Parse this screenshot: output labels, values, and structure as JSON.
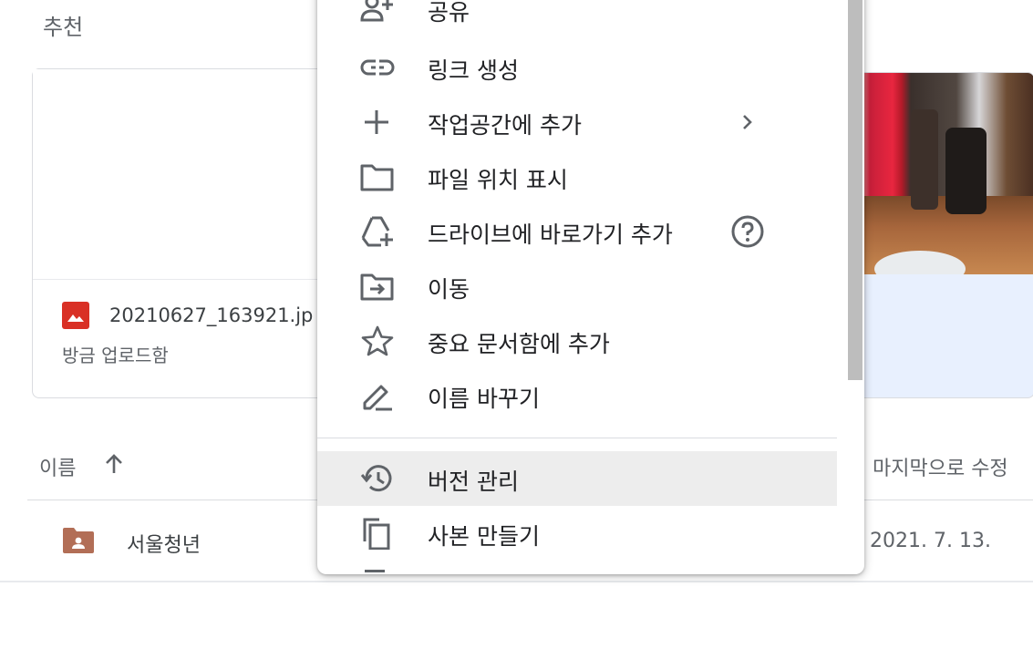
{
  "section": {
    "title": "추천"
  },
  "suggested": {
    "file_name": "20210627_163921.jp",
    "file_sub": "방금 업로드함",
    "file_type_icon": "image-icon",
    "file_type_color": "#d93025"
  },
  "list": {
    "header_name": "이름",
    "header_modified": "마지막으로 수정",
    "rows": [
      {
        "name": "서울청년",
        "modified": "2021. 7. 13.",
        "icon": "shared-folder-icon"
      }
    ]
  },
  "menu": {
    "items": [
      {
        "label": "공유",
        "icon": "person-add-icon"
      },
      {
        "label": "링크 생성",
        "icon": "link-icon"
      },
      {
        "label": "작업공간에 추가",
        "icon": "plus-icon",
        "right": "chevron-right-icon"
      },
      {
        "label": "파일 위치 표시",
        "icon": "folder-icon"
      },
      {
        "label": "드라이브에 바로가기 추가",
        "icon": "drive-add-icon",
        "right": "help-icon"
      },
      {
        "label": "이동",
        "icon": "move-folder-icon"
      },
      {
        "label": "중요 문서함에 추가",
        "icon": "star-icon"
      },
      {
        "label": "이름 바꾸기",
        "icon": "edit-icon"
      },
      {
        "label": "버전 관리",
        "icon": "history-icon",
        "highlighted": true
      },
      {
        "label": "사본 만들기",
        "icon": "copy-icon"
      }
    ]
  },
  "colors": {
    "highlight": "#ededed",
    "folder": "#b26e56",
    "card_bg": "#e8f0fe"
  }
}
